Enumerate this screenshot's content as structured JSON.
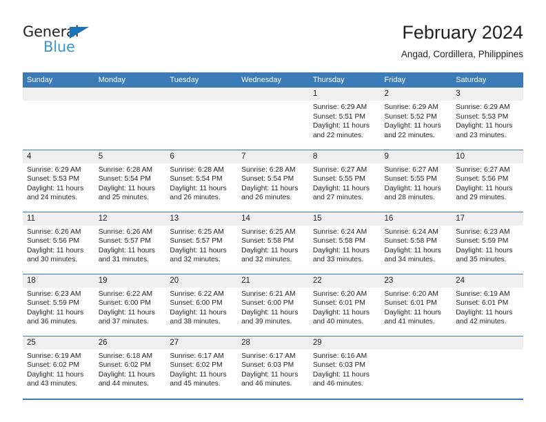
{
  "brand": {
    "name_top": "General",
    "name_bottom": "Blue",
    "accent_color": "#3a92d2",
    "triangle_color": "#1b75bb"
  },
  "header": {
    "month_title": "February 2024",
    "location": "Angad, Cordillera, Philippines"
  },
  "calendar": {
    "header_color": "#3b7cb8",
    "daynum_background": "#efefef",
    "weekdays": [
      "Sunday",
      "Monday",
      "Tuesday",
      "Wednesday",
      "Thursday",
      "Friday",
      "Saturday"
    ],
    "weeks": [
      [
        {
          "day": "",
          "sunrise": "",
          "sunset": "",
          "daylight": ""
        },
        {
          "day": "",
          "sunrise": "",
          "sunset": "",
          "daylight": ""
        },
        {
          "day": "",
          "sunrise": "",
          "sunset": "",
          "daylight": ""
        },
        {
          "day": "",
          "sunrise": "",
          "sunset": "",
          "daylight": ""
        },
        {
          "day": "1",
          "sunrise": "Sunrise: 6:29 AM",
          "sunset": "Sunset: 5:51 PM",
          "daylight": "Daylight: 11 hours and 22 minutes."
        },
        {
          "day": "2",
          "sunrise": "Sunrise: 6:29 AM",
          "sunset": "Sunset: 5:52 PM",
          "daylight": "Daylight: 11 hours and 22 minutes."
        },
        {
          "day": "3",
          "sunrise": "Sunrise: 6:29 AM",
          "sunset": "Sunset: 5:53 PM",
          "daylight": "Daylight: 11 hours and 23 minutes."
        }
      ],
      [
        {
          "day": "4",
          "sunrise": "Sunrise: 6:29 AM",
          "sunset": "Sunset: 5:53 PM",
          "daylight": "Daylight: 11 hours and 24 minutes."
        },
        {
          "day": "5",
          "sunrise": "Sunrise: 6:28 AM",
          "sunset": "Sunset: 5:54 PM",
          "daylight": "Daylight: 11 hours and 25 minutes."
        },
        {
          "day": "6",
          "sunrise": "Sunrise: 6:28 AM",
          "sunset": "Sunset: 5:54 PM",
          "daylight": "Daylight: 11 hours and 26 minutes."
        },
        {
          "day": "7",
          "sunrise": "Sunrise: 6:28 AM",
          "sunset": "Sunset: 5:54 PM",
          "daylight": "Daylight: 11 hours and 26 minutes."
        },
        {
          "day": "8",
          "sunrise": "Sunrise: 6:27 AM",
          "sunset": "Sunset: 5:55 PM",
          "daylight": "Daylight: 11 hours and 27 minutes."
        },
        {
          "day": "9",
          "sunrise": "Sunrise: 6:27 AM",
          "sunset": "Sunset: 5:55 PM",
          "daylight": "Daylight: 11 hours and 28 minutes."
        },
        {
          "day": "10",
          "sunrise": "Sunrise: 6:27 AM",
          "sunset": "Sunset: 5:56 PM",
          "daylight": "Daylight: 11 hours and 29 minutes."
        }
      ],
      [
        {
          "day": "11",
          "sunrise": "Sunrise: 6:26 AM",
          "sunset": "Sunset: 5:56 PM",
          "daylight": "Daylight: 11 hours and 30 minutes."
        },
        {
          "day": "12",
          "sunrise": "Sunrise: 6:26 AM",
          "sunset": "Sunset: 5:57 PM",
          "daylight": "Daylight: 11 hours and 31 minutes."
        },
        {
          "day": "13",
          "sunrise": "Sunrise: 6:25 AM",
          "sunset": "Sunset: 5:57 PM",
          "daylight": "Daylight: 11 hours and 32 minutes."
        },
        {
          "day": "14",
          "sunrise": "Sunrise: 6:25 AM",
          "sunset": "Sunset: 5:58 PM",
          "daylight": "Daylight: 11 hours and 32 minutes."
        },
        {
          "day": "15",
          "sunrise": "Sunrise: 6:24 AM",
          "sunset": "Sunset: 5:58 PM",
          "daylight": "Daylight: 11 hours and 33 minutes."
        },
        {
          "day": "16",
          "sunrise": "Sunrise: 6:24 AM",
          "sunset": "Sunset: 5:58 PM",
          "daylight": "Daylight: 11 hours and 34 minutes."
        },
        {
          "day": "17",
          "sunrise": "Sunrise: 6:23 AM",
          "sunset": "Sunset: 5:59 PM",
          "daylight": "Daylight: 11 hours and 35 minutes."
        }
      ],
      [
        {
          "day": "18",
          "sunrise": "Sunrise: 6:23 AM",
          "sunset": "Sunset: 5:59 PM",
          "daylight": "Daylight: 11 hours and 36 minutes."
        },
        {
          "day": "19",
          "sunrise": "Sunrise: 6:22 AM",
          "sunset": "Sunset: 6:00 PM",
          "daylight": "Daylight: 11 hours and 37 minutes."
        },
        {
          "day": "20",
          "sunrise": "Sunrise: 6:22 AM",
          "sunset": "Sunset: 6:00 PM",
          "daylight": "Daylight: 11 hours and 38 minutes."
        },
        {
          "day": "21",
          "sunrise": "Sunrise: 6:21 AM",
          "sunset": "Sunset: 6:00 PM",
          "daylight": "Daylight: 11 hours and 39 minutes."
        },
        {
          "day": "22",
          "sunrise": "Sunrise: 6:20 AM",
          "sunset": "Sunset: 6:01 PM",
          "daylight": "Daylight: 11 hours and 40 minutes."
        },
        {
          "day": "23",
          "sunrise": "Sunrise: 6:20 AM",
          "sunset": "Sunset: 6:01 PM",
          "daylight": "Daylight: 11 hours and 41 minutes."
        },
        {
          "day": "24",
          "sunrise": "Sunrise: 6:19 AM",
          "sunset": "Sunset: 6:01 PM",
          "daylight": "Daylight: 11 hours and 42 minutes."
        }
      ],
      [
        {
          "day": "25",
          "sunrise": "Sunrise: 6:19 AM",
          "sunset": "Sunset: 6:02 PM",
          "daylight": "Daylight: 11 hours and 43 minutes."
        },
        {
          "day": "26",
          "sunrise": "Sunrise: 6:18 AM",
          "sunset": "Sunset: 6:02 PM",
          "daylight": "Daylight: 11 hours and 44 minutes."
        },
        {
          "day": "27",
          "sunrise": "Sunrise: 6:17 AM",
          "sunset": "Sunset: 6:02 PM",
          "daylight": "Daylight: 11 hours and 45 minutes."
        },
        {
          "day": "28",
          "sunrise": "Sunrise: 6:17 AM",
          "sunset": "Sunset: 6:03 PM",
          "daylight": "Daylight: 11 hours and 46 minutes."
        },
        {
          "day": "29",
          "sunrise": "Sunrise: 6:16 AM",
          "sunset": "Sunset: 6:03 PM",
          "daylight": "Daylight: 11 hours and 46 minutes."
        },
        {
          "day": "",
          "sunrise": "",
          "sunset": "",
          "daylight": ""
        },
        {
          "day": "",
          "sunrise": "",
          "sunset": "",
          "daylight": ""
        }
      ]
    ]
  }
}
